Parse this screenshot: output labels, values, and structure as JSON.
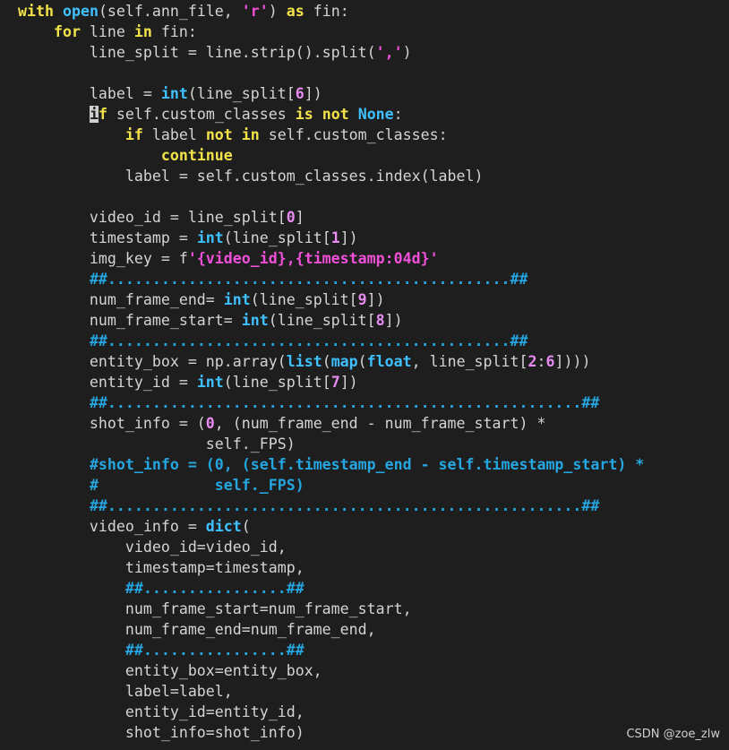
{
  "watermark": "CSDN @zoe_zlw",
  "code_lines": [
    "with open(self.ann_file, 'r') as fin:",
    "    for line in fin:",
    "        line_split = line.strip().split(',')",
    "",
    "        label = int(line_split[6])",
    "        if self.custom_classes is not None:",
    "            if label not in self.custom_classes:",
    "                continue",
    "            label = self.custom_classes.index(label)",
    "",
    "        video_id = line_split[0]",
    "        timestamp = int(line_split[1])",
    "        img_key = f'{video_id},{timestamp:04d}'",
    "        ##.............................................##",
    "        num_frame_end= int(line_split[9])",
    "        num_frame_start= int(line_split[8])",
    "        ##.............................................##",
    "        entity_box = np.array(list(map(float, line_split[2:6])))",
    "        entity_id = int(line_split[7])",
    "        ##.....................................................##",
    "        shot_info = (0, (num_frame_end - num_frame_start) *",
    "                     self._FPS)",
    "        #shot_info = (0, (self.timestamp_end - self.timestamp_start) *",
    "        #             self._FPS)",
    "        ##.....................................................##",
    "        video_info = dict(",
    "            video_id=video_id,",
    "            timestamp=timestamp,",
    "            ##................##",
    "            num_frame_start=num_frame_start,",
    "            num_frame_end=num_frame_end,",
    "            ##................##",
    "            entity_box=entity_box,",
    "            label=label,",
    "            entity_id=entity_id,",
    "            shot_info=shot_info)"
  ]
}
